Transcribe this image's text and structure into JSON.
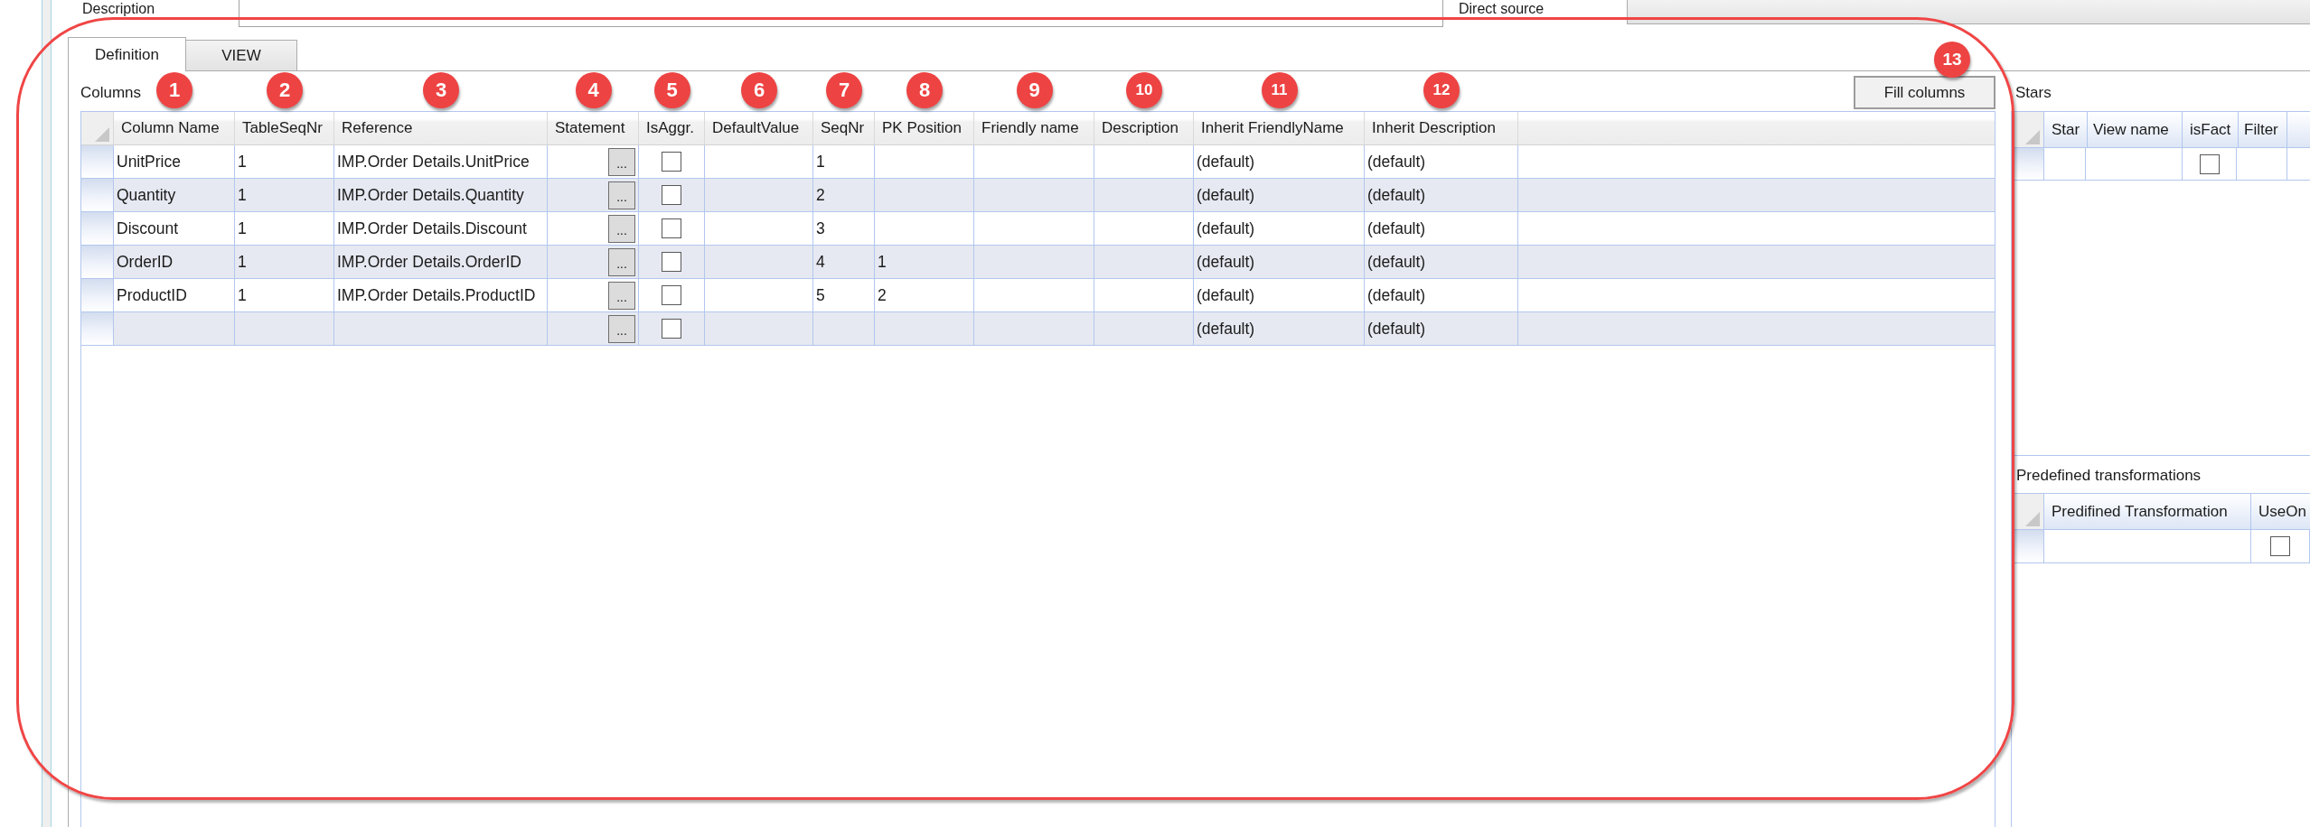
{
  "top_fields": [
    {
      "label": "Description",
      "kind": "input"
    },
    {
      "label": "Direct source",
      "kind": "combo"
    }
  ],
  "tabs": [
    {
      "label": "Definition",
      "selected": true
    },
    {
      "label": "VIEW",
      "selected": false
    }
  ],
  "columns_panel": {
    "title": "Columns",
    "fill_button": {
      "label": "Fill columns",
      "callout": "13"
    },
    "columns": [
      {
        "label": "Column Name",
        "callout": "1"
      },
      {
        "label": "TableSeqNr",
        "callout": "2"
      },
      {
        "label": "Reference",
        "callout": "3"
      },
      {
        "label": "Statement",
        "callout": "4"
      },
      {
        "label": "IsAggr.",
        "callout": "5"
      },
      {
        "label": "DefaultValue",
        "callout": "6"
      },
      {
        "label": "SeqNr",
        "callout": "7"
      },
      {
        "label": "PK Position",
        "callout": "8"
      },
      {
        "label": "Friendly name",
        "callout": "9"
      },
      {
        "label": "Description",
        "callout": "10"
      },
      {
        "label": "Inherit FriendlyName",
        "callout": "11"
      },
      {
        "label": "Inherit Description",
        "callout": "12"
      }
    ],
    "rows": [
      {
        "cells": [
          {
            "kind": "text",
            "text": "UnitPrice"
          },
          {
            "kind": "text",
            "text": "1"
          },
          {
            "kind": "text",
            "text": "IMP.Order Details.UnitPrice"
          },
          {
            "kind": "button",
            "label": "..."
          },
          {
            "kind": "checkbox",
            "checked": false
          },
          {
            "kind": "text"
          },
          {
            "kind": "text",
            "text": "1"
          },
          {
            "kind": "text"
          },
          {
            "kind": "text"
          },
          {
            "kind": "text"
          },
          {
            "kind": "text",
            "text": "(default)"
          },
          {
            "kind": "text",
            "text": "(default)"
          }
        ]
      },
      {
        "cells": [
          {
            "kind": "text",
            "text": "Quantity"
          },
          {
            "kind": "text",
            "text": "1"
          },
          {
            "kind": "text",
            "text": "IMP.Order Details.Quantity"
          },
          {
            "kind": "button",
            "label": "..."
          },
          {
            "kind": "checkbox",
            "checked": false
          },
          {
            "kind": "text"
          },
          {
            "kind": "text",
            "text": "2"
          },
          {
            "kind": "text"
          },
          {
            "kind": "text"
          },
          {
            "kind": "text"
          },
          {
            "kind": "text",
            "text": "(default)"
          },
          {
            "kind": "text",
            "text": "(default)"
          }
        ]
      },
      {
        "cells": [
          {
            "kind": "text",
            "text": "Discount"
          },
          {
            "kind": "text",
            "text": "1"
          },
          {
            "kind": "text",
            "text": "IMP.Order Details.Discount"
          },
          {
            "kind": "button",
            "label": "..."
          },
          {
            "kind": "checkbox",
            "checked": false
          },
          {
            "kind": "text"
          },
          {
            "kind": "text",
            "text": "3"
          },
          {
            "kind": "text"
          },
          {
            "kind": "text"
          },
          {
            "kind": "text"
          },
          {
            "kind": "text",
            "text": "(default)"
          },
          {
            "kind": "text",
            "text": "(default)"
          }
        ]
      },
      {
        "cells": [
          {
            "kind": "text",
            "text": "OrderID"
          },
          {
            "kind": "text",
            "text": "1"
          },
          {
            "kind": "text",
            "text": "IMP.Order Details.OrderID"
          },
          {
            "kind": "button",
            "label": "..."
          },
          {
            "kind": "checkbox",
            "checked": false
          },
          {
            "kind": "text"
          },
          {
            "kind": "text",
            "text": "4"
          },
          {
            "kind": "text",
            "text": "1"
          },
          {
            "kind": "text"
          },
          {
            "kind": "text"
          },
          {
            "kind": "text",
            "text": "(default)"
          },
          {
            "kind": "text",
            "text": "(default)"
          }
        ]
      },
      {
        "cells": [
          {
            "kind": "text",
            "text": "ProductID"
          },
          {
            "kind": "text",
            "text": "1"
          },
          {
            "kind": "text",
            "text": "IMP.Order Details.ProductID"
          },
          {
            "kind": "button",
            "label": "..."
          },
          {
            "kind": "checkbox",
            "checked": false
          },
          {
            "kind": "text"
          },
          {
            "kind": "text",
            "text": "5"
          },
          {
            "kind": "text",
            "text": "2"
          },
          {
            "kind": "text"
          },
          {
            "kind": "text"
          },
          {
            "kind": "text",
            "text": "(default)"
          },
          {
            "kind": "text",
            "text": "(default)"
          }
        ]
      },
      {
        "cells": [
          {
            "kind": "text"
          },
          {
            "kind": "text"
          },
          {
            "kind": "text"
          },
          {
            "kind": "button",
            "label": "..."
          },
          {
            "kind": "checkbox",
            "checked": false
          },
          {
            "kind": "text"
          },
          {
            "kind": "text"
          },
          {
            "kind": "text"
          },
          {
            "kind": "text"
          },
          {
            "kind": "text"
          },
          {
            "kind": "text",
            "text": "(default)"
          },
          {
            "kind": "text",
            "text": "(default)"
          }
        ]
      }
    ]
  },
  "stars_panel": {
    "title": "Stars",
    "columns": [
      {
        "label": "Star"
      },
      {
        "label": "View name"
      },
      {
        "label": "isFact"
      },
      {
        "label": "Filter"
      }
    ],
    "rows": [
      {
        "cells": [
          {
            "kind": "text"
          },
          {
            "kind": "text"
          },
          {
            "kind": "checkbox",
            "checked": false
          },
          {
            "kind": "text"
          }
        ]
      }
    ]
  },
  "transformations_panel": {
    "title": "Predefined transformations",
    "columns": [
      {
        "label": "Predifined Transformation"
      },
      {
        "label": "UseOn"
      }
    ],
    "rows": [
      {
        "cells": [
          {
            "kind": "text"
          },
          {
            "kind": "checkbox",
            "checked": false
          }
        ]
      }
    ]
  }
}
